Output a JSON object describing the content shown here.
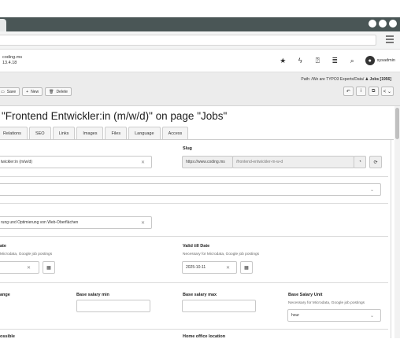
{
  "browser": {
    "menu_icon": "hamburger-icon"
  },
  "topbar": {
    "site_name": "coding.ms",
    "version": "13.4.18",
    "user_name": "sysadmin",
    "user_initial": "●"
  },
  "docheader": {
    "path_prefix": "Path: /We are TYPO3 Experts/Data/",
    "page_name": "Jobs [1956]",
    "save_label": "Save",
    "new_label": "New",
    "delete_label": "Delete",
    "info_label": "i"
  },
  "title": "\"Frontend Entwickler:in (m/w/d)\" on page \"Jobs\"",
  "tabs": [
    "Relations",
    "SEO",
    "Links",
    "Images",
    "Files",
    "Language",
    "Access"
  ],
  "form": {
    "title_value": "twickler:in (m/w/d)",
    "slug_label": "Slug",
    "slug_prefix": "https://www.coding.ms",
    "slug_value": "/frontend-entwickler-m-w-d",
    "teaser_value": "rung und Optimierung von Web-Oberflächen",
    "date_label": "ate",
    "date_help": "Microdata, Google job postings",
    "valid_label": "Valid till Date",
    "valid_help": "Necessary for Microdata, Google job postings",
    "valid_value": "2025-10-11",
    "range_label": "ange",
    "salary_min_label": "Base salary min",
    "salary_max_label": "Base salary max",
    "salary_unit_label": "Base Salary Unit",
    "salary_unit_help": "Necessary for Microdata, Google job postings",
    "salary_unit_value": "hour",
    "possible_label": "ossible",
    "home_office_label": "Home office location"
  }
}
